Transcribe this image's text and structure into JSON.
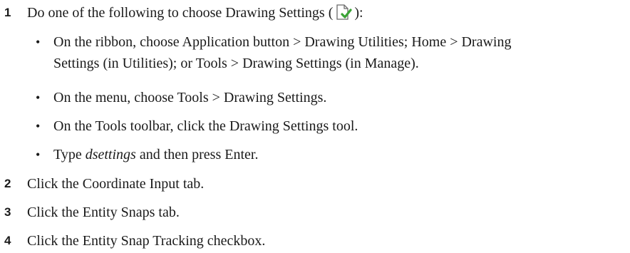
{
  "steps": [
    {
      "number": "1",
      "text_before_icon": "Do one of the following to choose Drawing Settings (",
      "icon": "drawing-settings-icon",
      "text_after_icon": "):"
    },
    {
      "number": "2",
      "text": "Click the Coordinate Input tab."
    },
    {
      "number": "3",
      "text": "Click the Entity Snaps tab."
    },
    {
      "number": "4",
      "text": "Click the Entity Snap Tracking checkbox."
    }
  ],
  "bullets": [
    {
      "line1": "On the ribbon, choose Application button > Drawing Utilities; Home > Drawing",
      "line2": "Settings (in Utilities); or Tools > Drawing Settings (in Manage)."
    },
    {
      "text": "On the menu, choose Tools > Drawing Settings."
    },
    {
      "text": "On the Tools toolbar, click the Drawing Settings tool."
    },
    {
      "prefix": "Type ",
      "command": "dsettings",
      "suffix": " and then press Enter."
    }
  ],
  "colors": {
    "icon_check": "#3aa335",
    "icon_page": "#6b6b6b"
  }
}
